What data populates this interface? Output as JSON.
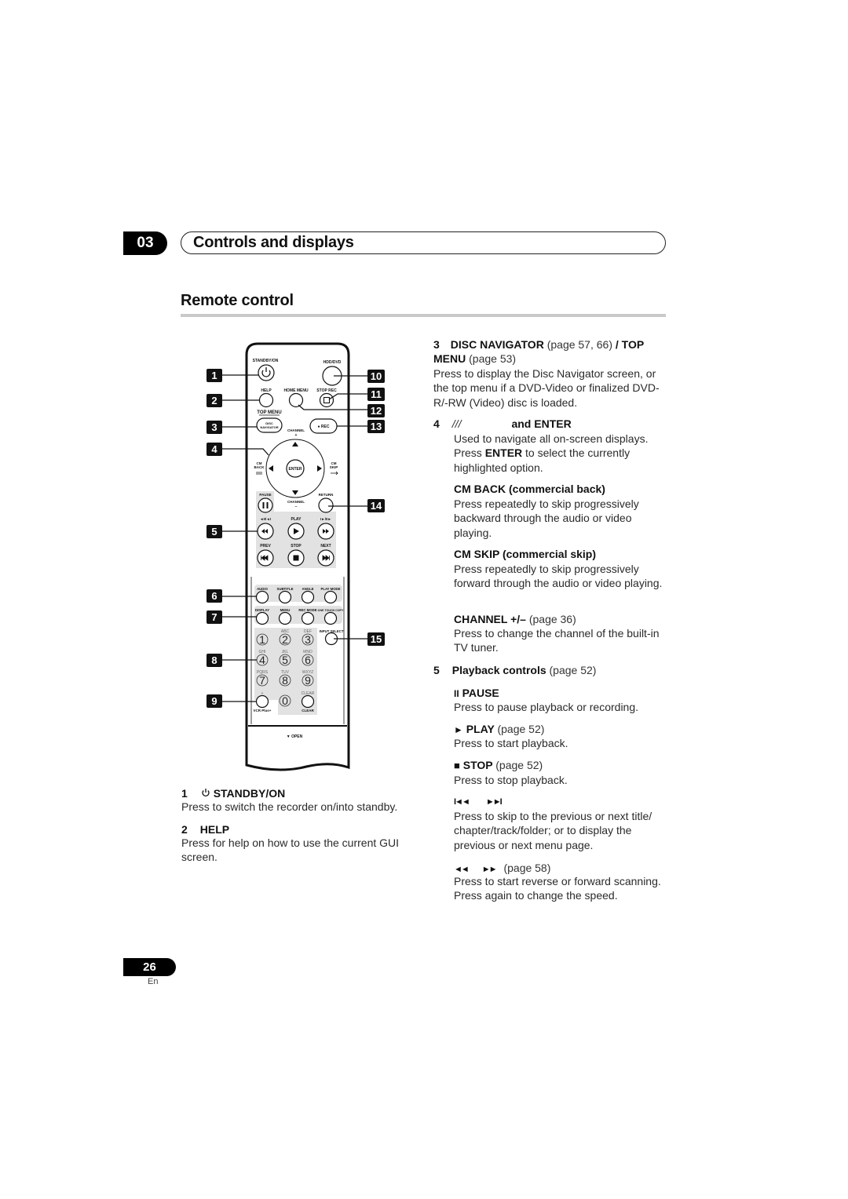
{
  "chapter": {
    "number": "03",
    "title": "Controls and displays"
  },
  "section": {
    "title": "Remote control"
  },
  "remote": {
    "callouts_left": [
      "1",
      "2",
      "3",
      "4",
      "5",
      "6",
      "7",
      "8",
      "9"
    ],
    "callouts_right": [
      "10",
      "11",
      "12",
      "13",
      "14",
      "15"
    ],
    "labels": {
      "standby": "STANDBY/ON",
      "hdd_dvd": "HDD/DVD",
      "help": "HELP",
      "home_menu": "HOME MENU",
      "stop_rec": "STOP REC",
      "top_menu": "TOP MENU",
      "disc": "DISC",
      "navigator": "NAVIGATOR",
      "channel": "CHANNEL",
      "plus": "+",
      "minus": "–",
      "rec": "● REC",
      "cm_back_1": "CM",
      "cm_back_2": "BACK",
      "cm_skip_1": "CM",
      "cm_skip_2": "SKIP",
      "enter": "ENTER",
      "pause": "PAUSE",
      "return": "RETURN",
      "slow_rev": "◄II/◄I",
      "play": "PLAY",
      "slow_fwd": "I►/II►",
      "prev": "PREV",
      "stop": "STOP",
      "next": "NEXT",
      "audio": "AUDIO",
      "subtitle": "SUBTITLE",
      "angle": "ANGLE",
      "play_mode": "PLAY MODE",
      "display": "DISPLAY",
      "menu": "MENU",
      "rec_mode": "REC MODE",
      "one_touch_copy": "ONE TOUCH COPY",
      "input_select": "INPUT SELECT",
      "abc": "ABC",
      "def": "DEF",
      "ghi": "GHI",
      "jkl": "JKL",
      "mno": "MNO",
      "pqrs": "PQRS",
      "tuv": "TUV",
      "wxyz": "WXYZ",
      "clear_top": "CLEAR",
      "clear": "CLEAR",
      "vcr_plus": "VCR Plus+",
      "vcr_plus_top": "+",
      "open": "▼  OPEN",
      "digits": [
        "1",
        "2",
        "3",
        "4",
        "5",
        "6",
        "7",
        "8",
        "9",
        "0"
      ]
    }
  },
  "descriptions": {
    "item1": {
      "num": "1",
      "icon": "power-icon",
      "title": "STANDBY/ON",
      "body": "Press to switch the recorder on/into standby."
    },
    "item2": {
      "num": "2",
      "title": "HELP",
      "body": "Press for help on how to use the current GUI screen."
    },
    "item3": {
      "num": "3",
      "title": "DISC NAVIGATOR",
      "ref": "(page 57, 66)",
      "title2": "/ TOP MENU",
      "ref2": "(page 53)",
      "body": "Press to display the Disc Navigator screen, or the top menu if a DVD-Video or finalized DVD-R/-RW (Video) disc is loaded."
    },
    "item4": {
      "num": "4",
      "title": "///",
      "title_tail": "and ENTER",
      "body_a": "Used to navigate all on-screen displays. Press ",
      "body_bold": "ENTER",
      "body_b": " to select the currently highlighted option."
    },
    "cm_back": {
      "title": "CM BACK (commercial back)",
      "body": "Press repeatedly to skip progressively backward through the audio or video playing."
    },
    "cm_skip": {
      "title": "CM SKIP (commercial skip)",
      "body": "Press repeatedly to skip progressively forward through the audio or video playing."
    },
    "channel": {
      "title": "CHANNEL +/–",
      "ref": "(page 36)",
      "body": "Press to change the channel of the built-in TV tuner."
    },
    "item5": {
      "num": "5",
      "title": "Playback controls",
      "ref": "(page 52)"
    },
    "pause": {
      "icon": "II",
      "title": "PAUSE",
      "body": "Press to pause playback or recording."
    },
    "play": {
      "icon": "►",
      "title": "PLAY",
      "ref": "(page 52)",
      "body": "Press to start playback."
    },
    "stop": {
      "icon": "■",
      "title": "STOP",
      "ref": "(page 52)",
      "body": "Press to stop playback."
    },
    "skip": {
      "icon_prev": "I◄◄",
      "icon_next": "►►I",
      "body": "Press to skip to the previous or next title/ chapter/track/folder; or to display the previous or next menu page."
    },
    "scan": {
      "icon_rev": "◄◄",
      "icon_fwd": "►►",
      "ref": "(page 58)",
      "body": "Press to start reverse or forward scanning. Press again to change the speed."
    }
  },
  "footer": {
    "page": "26",
    "lang": "En"
  }
}
